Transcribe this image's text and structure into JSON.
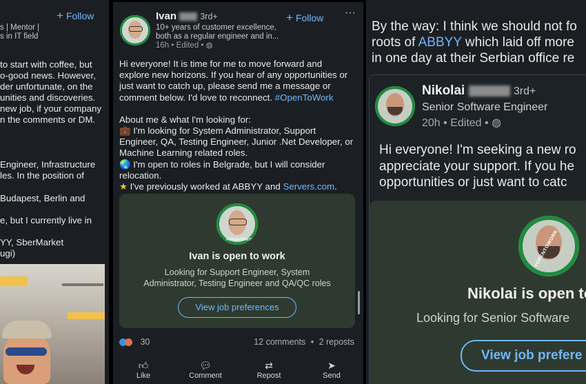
{
  "panel_left": {
    "follow_label": "Follow",
    "headline_lines": [
      "s | Mentor |",
      "s in IT field"
    ],
    "body_lines": [
      "to start with coffee, but",
      "o-good news. However,",
      "der unfortunate, on the",
      "unities and discoveries.",
      "new job, if your company",
      "n the comments or DM.",
      "",
      "",
      "Engineer, Infrastructure",
      "les. In the position of",
      "",
      "Budapest, Berlin and",
      "",
      "e, but I currently live in",
      "",
      "YY, SberMarket",
      "ugi)"
    ]
  },
  "panel_middle": {
    "author_name": "Ivan",
    "degree": "3rd+",
    "headline_1": "10+ years of customer excellence,",
    "headline_2": "both as a regular engineer and in...",
    "meta": "16h • Edited •",
    "follow_label": "Follow",
    "more_label": "···",
    "post_lines": [
      "Hi everyone! It is time for me to move forward and",
      "explore new horizons. If you hear of any opportunities or",
      "just want to catch up, please send me a message or",
      "comment below. I'd love to reconnect."
    ],
    "hashtag": "#OpenToWork",
    "about_heading": "About me & what I'm looking for:",
    "bullet_1_lines": [
      "I'm looking for System Administrator, Support",
      "Engineer, QA, Testing Engineer, Junior .Net Developer, or",
      "Machine Learning related roles."
    ],
    "bullet_2_lines": [
      "I'm open to roles in Belgrade, but I will consider",
      "relocation."
    ],
    "bullet_3_text": "I've previously worked at ABBYY and",
    "bullet_3_link": "Servers.com",
    "bullet_3_end": ".",
    "card": {
      "title": "Ivan is open to work",
      "desc_1": "Looking for Support Engineer, System",
      "desc_2": "Administrator, Testing Engineer and QA/QC roles",
      "button": "View job preferences"
    },
    "reactions_count": "30",
    "comments": "12 comments",
    "separator": "•",
    "reposts": "2 reposts",
    "actions": [
      {
        "icon": "like-icon",
        "label": "Like"
      },
      {
        "icon": "comment-icon",
        "label": "Comment"
      },
      {
        "icon": "repost-icon",
        "label": "Repost"
      },
      {
        "icon": "send-icon",
        "label": "Send"
      }
    ]
  },
  "panel_right": {
    "intro_lines": [
      "By the way: I think we should not fo",
      "roots of",
      "which laid off more",
      "in one day at their Serbian office re"
    ],
    "intro_link": "ABBYY",
    "author_name": "Nikolai",
    "degree": "3rd+",
    "headline": "Senior Software Engineer",
    "meta": "20h • Edited •",
    "post_lines": [
      "Hi everyone! I'm seeking a new ro",
      "appreciate your support. If you he",
      "opportunities or just want to catc"
    ],
    "card": {
      "title": "Nikolai is open to",
      "desc": "Looking for Senior Software",
      "button": "View job prefere"
    }
  },
  "badges": {
    "otw_label": "#OPENTOWORK"
  },
  "colors": {
    "accent": "#71b7fb",
    "background": "#1b1f23",
    "card": "#2e3a2f",
    "otw_green": "#1f8b3f"
  }
}
